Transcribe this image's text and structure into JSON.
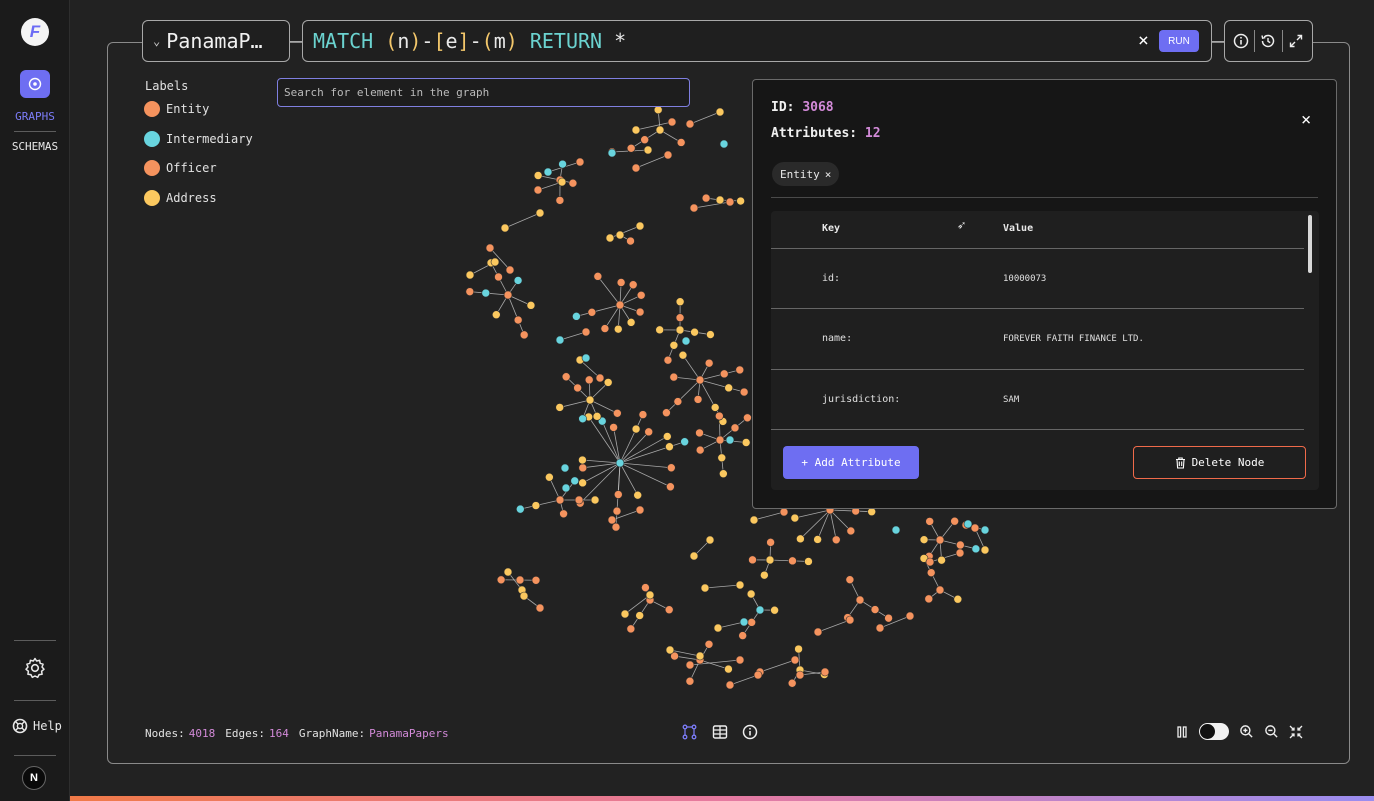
{
  "app": {
    "logo_letter": "F",
    "nav": {
      "graphs_label": "GRAPHS",
      "schemas_label": "SCHEMAS",
      "help_label": "Help",
      "avatar_letter": "N"
    }
  },
  "toolbar": {
    "graph_name": "PanamaP…",
    "query": {
      "kw1": "MATCH",
      "p1": "(",
      "n": "n",
      "p2": ")",
      "dash1": "-",
      "b1": "[",
      "e": "e",
      "b2": "]",
      "dash2": "-",
      "p3": "(",
      "m": "m",
      "p4": ")",
      "kw2": "RETURN",
      "star": "*"
    },
    "clear_label": "×",
    "run_label": "RUN"
  },
  "legend": {
    "title": "Labels",
    "items": [
      {
        "label": "Entity",
        "color": "#f5935e"
      },
      {
        "label": "Intermediary",
        "color": "#68d4de"
      },
      {
        "label": "Officer",
        "color": "#f5935e"
      },
      {
        "label": "Address",
        "color": "#fbc85f"
      }
    ]
  },
  "search": {
    "placeholder": "Search for element in the graph"
  },
  "panel": {
    "id_label": "ID:",
    "id_value": "3068",
    "attrs_label": "Attributes:",
    "attrs_value": "12",
    "chip_label": "Entity",
    "chip_remove": "×",
    "close": "×",
    "header_key": "Key",
    "header_value": "Value",
    "rows": [
      {
        "key": "id:",
        "value": "10000073"
      },
      {
        "key": "name:",
        "value": "FOREVER FAITH FINANCE LTD."
      },
      {
        "key": "jurisdiction:",
        "value": "SAM"
      }
    ],
    "add_button": "+ Add Attribute",
    "delete_button": "Delete Node"
  },
  "status": {
    "nodes_label": "Nodes:",
    "nodes_value": "4018",
    "edges_label": "Edges:",
    "edges_value": "164",
    "graphname_label": "GraphName:",
    "graphname_value": "PanamaPapers"
  },
  "colors": {
    "entity": "#f5935e",
    "intermediary": "#68d4de",
    "address": "#fbc85f",
    "accent": "#6e6ef2"
  }
}
